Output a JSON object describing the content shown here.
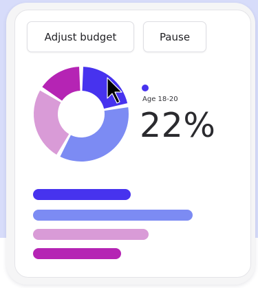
{
  "actions": {
    "adjust_label": "Adjust budget",
    "pause_label": "Pause"
  },
  "highlight": {
    "label": "Age 18-20",
    "percent": "22%",
    "color": "#4733ee"
  },
  "segments": [
    {
      "color": "#4733ee",
      "share": 0.22
    },
    {
      "color": "#7c8bf3",
      "share": 0.36
    },
    {
      "color": "#d99bd7",
      "share": 0.26
    },
    {
      "color": "#b524b4",
      "share": 0.16
    }
  ],
  "bars": [
    {
      "color": "#4733ee",
      "value": 0.22
    },
    {
      "color": "#7c8bf3",
      "value": 0.36
    },
    {
      "color": "#d99bd7",
      "value": 0.26
    },
    {
      "color": "#b524b4",
      "value": 0.16
    }
  ],
  "icons": {
    "pointer": "cursor-arrow-icon"
  }
}
